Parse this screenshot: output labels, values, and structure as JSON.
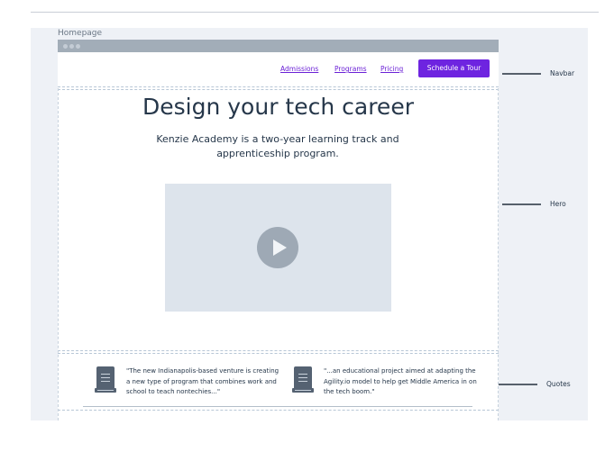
{
  "board": {
    "title": "Homepage"
  },
  "navbar": {
    "links": [
      "Admissions",
      "Programs",
      "Pricing"
    ],
    "cta_label": "Schedule a Tour"
  },
  "hero": {
    "title": "Design your tech career",
    "subtitle": "Kenzie Academy is a two-year learning track and apprenticeship program."
  },
  "quotes": [
    {
      "text": "\"The new Indianapolis-based venture is creating a new type of program that combines work and school to teach nontechies...\""
    },
    {
      "text": "\"...an educational project aimed at adapting the Agility.io model to help get Middle America in on the tech boom.\""
    }
  ],
  "annotations": {
    "navbar": "Navbar",
    "hero": "Hero",
    "quotes": "Quotes"
  },
  "colors": {
    "accent": "#6e24e0",
    "link": "#6b21d6",
    "text": "#26374a",
    "chrome": "#a2adb8",
    "board": "#eef1f6"
  }
}
